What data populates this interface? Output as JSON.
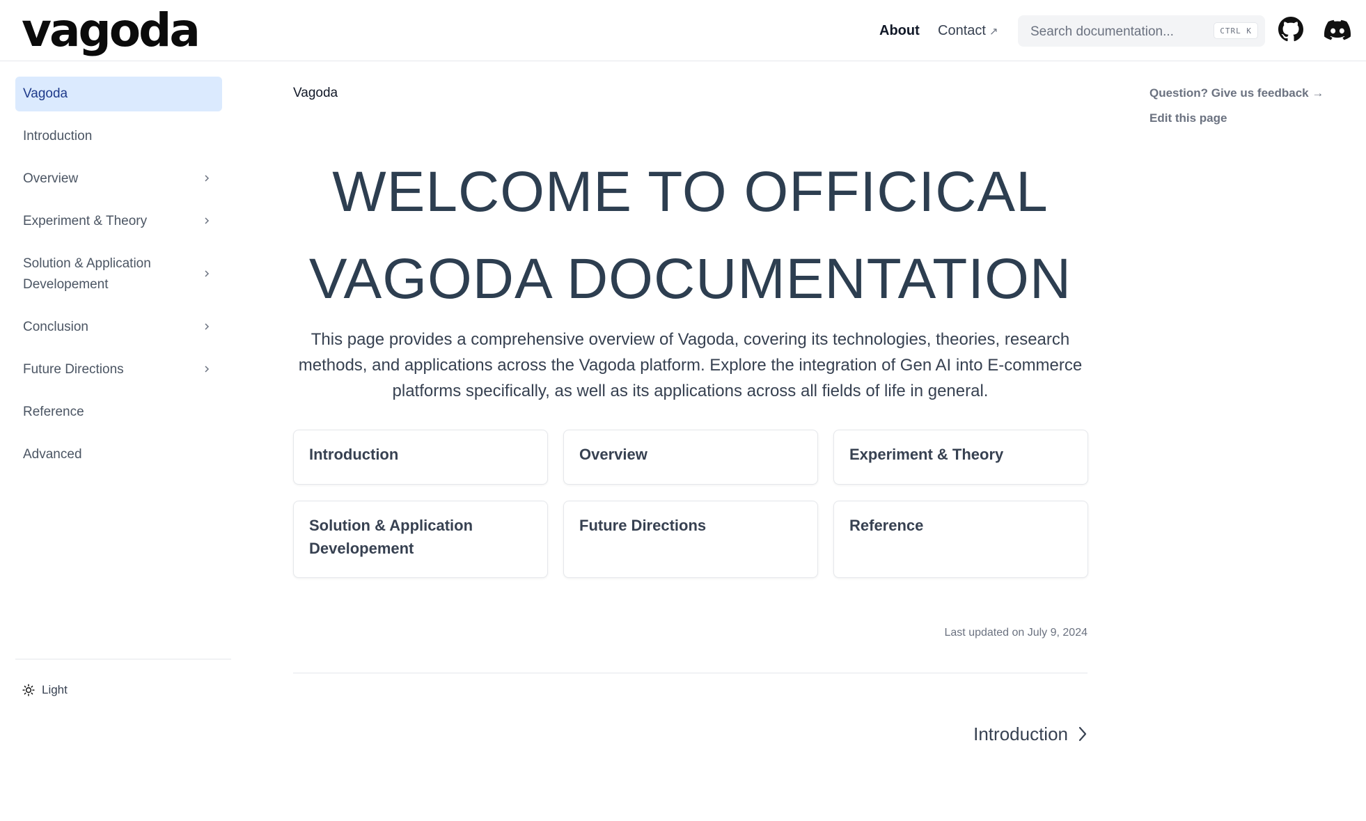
{
  "header": {
    "logo_text": "vagoda",
    "nav": {
      "about": "About",
      "contact": "Contact",
      "contact_icon": "↗"
    },
    "search": {
      "placeholder": "Search documentation...",
      "shortcut": "CTRL K"
    },
    "icons": [
      "github-icon",
      "discord-icon"
    ]
  },
  "sidebar": {
    "items": [
      {
        "label": "Vagoda",
        "active": true
      },
      {
        "label": "Introduction"
      },
      {
        "label": "Overview",
        "expandable": true
      },
      {
        "label": "Experiment & Theory",
        "expandable": true
      },
      {
        "label": "Solution & Application Developement",
        "expandable": true
      },
      {
        "label": "Conclusion",
        "expandable": true
      },
      {
        "label": "Future Directions",
        "expandable": true
      },
      {
        "label": "Reference"
      },
      {
        "label": "Advanced"
      }
    ],
    "theme_label": "Light"
  },
  "main": {
    "breadcrumb": "Vagoda",
    "title": "WELCOME TO OFFICICAL VAGODA DOCUMENTATION",
    "description": "This page provides a comprehensive overview of Vagoda, covering its technologies, theories, research methods, and applications across the Vagoda platform. Explore the integration of Gen AI into E-commerce platforms specifically, as well as its applications across all fields of life in general.",
    "cards": [
      "Introduction",
      "Overview",
      "Experiment & Theory",
      "Solution & Application Developement",
      "Future Directions",
      "Reference"
    ],
    "last_updated": "Last updated on July 9, 2024",
    "next_link": "Introduction"
  },
  "toc": {
    "feedback": "Question? Give us feedback →",
    "edit": "Edit this page"
  },
  "colors": {
    "active_bg": "#dbeafe",
    "active_text": "#1e3a8a",
    "title_text": "#2d3e50",
    "border": "#e5e7eb"
  }
}
